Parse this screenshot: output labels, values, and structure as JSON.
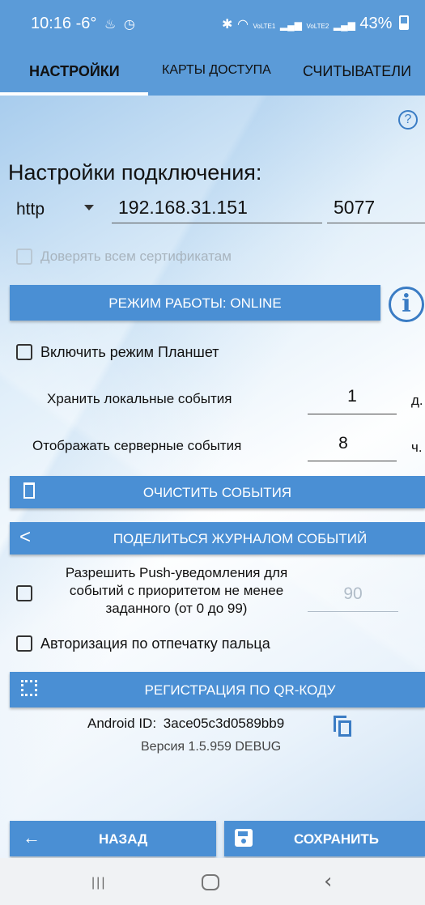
{
  "status_bar": {
    "time": "10:16 -6°",
    "icons": [
      "fire-icon",
      "timer-icon",
      "bluetooth-icon",
      "wifi-icon",
      "signal-icon",
      "signal-icon"
    ],
    "lte1": "VoLTE1",
    "lte2": "VoLTE2",
    "battery": "43%"
  },
  "tabs": [
    {
      "label": "НАСТРОЙКИ",
      "active": true
    },
    {
      "label": "КАРТЫ ДОСТУПА",
      "active": false
    },
    {
      "label": "СЧИТЫВАТЕЛИ",
      "active": false
    }
  ],
  "connection": {
    "heading": "Настройки подключения:",
    "protocol": "http",
    "ip": "192.168.31.151",
    "port": "5077",
    "trust_all_certs_label": "Доверять всем сертификатам",
    "trust_all_certs_checked": false
  },
  "mode_button": {
    "label": "РЕЖИМ РАБОТЫ: ONLINE"
  },
  "tablet_mode": {
    "label": "Включить режим Планшет",
    "checked": false
  },
  "local_events": {
    "label": "Хранить локальные события",
    "value": "1",
    "unit": "д."
  },
  "server_events": {
    "label": "Отображать серверные события",
    "value": "8",
    "unit": "ч."
  },
  "clear_button": {
    "label": "ОЧИСТИТЬ СОБЫТИЯ",
    "icon": "trash-icon"
  },
  "share_button": {
    "label": "ПОДЕЛИТЬСЯ ЖУРНАЛОМ СОБЫТИЙ",
    "icon": "share-icon"
  },
  "push": {
    "line1": "Разрешить Push-уведомления для",
    "line2": "событий с приоритетом не менее",
    "line3": "заданного (от 0 до 99)",
    "value": "90",
    "checked": false
  },
  "fingerprint": {
    "label": "Авторизация по отпечатку пальца",
    "checked": false
  },
  "qr_button": {
    "label": "РЕГИСТРАЦИЯ ПО QR-КОДУ",
    "icon": "qr-code-icon"
  },
  "android_id": {
    "label": "Android ID:",
    "value": "3ace05c3d0589bb9"
  },
  "version": "Версия 1.5.959 DEBUG",
  "back_button": {
    "label": "НАЗАД"
  },
  "save_button": {
    "label": "СОХРАНИТЬ"
  },
  "colors": {
    "primary": "#4a8fd4",
    "accent": "#3a7cc4",
    "tabbar": "#5b9bd8"
  }
}
